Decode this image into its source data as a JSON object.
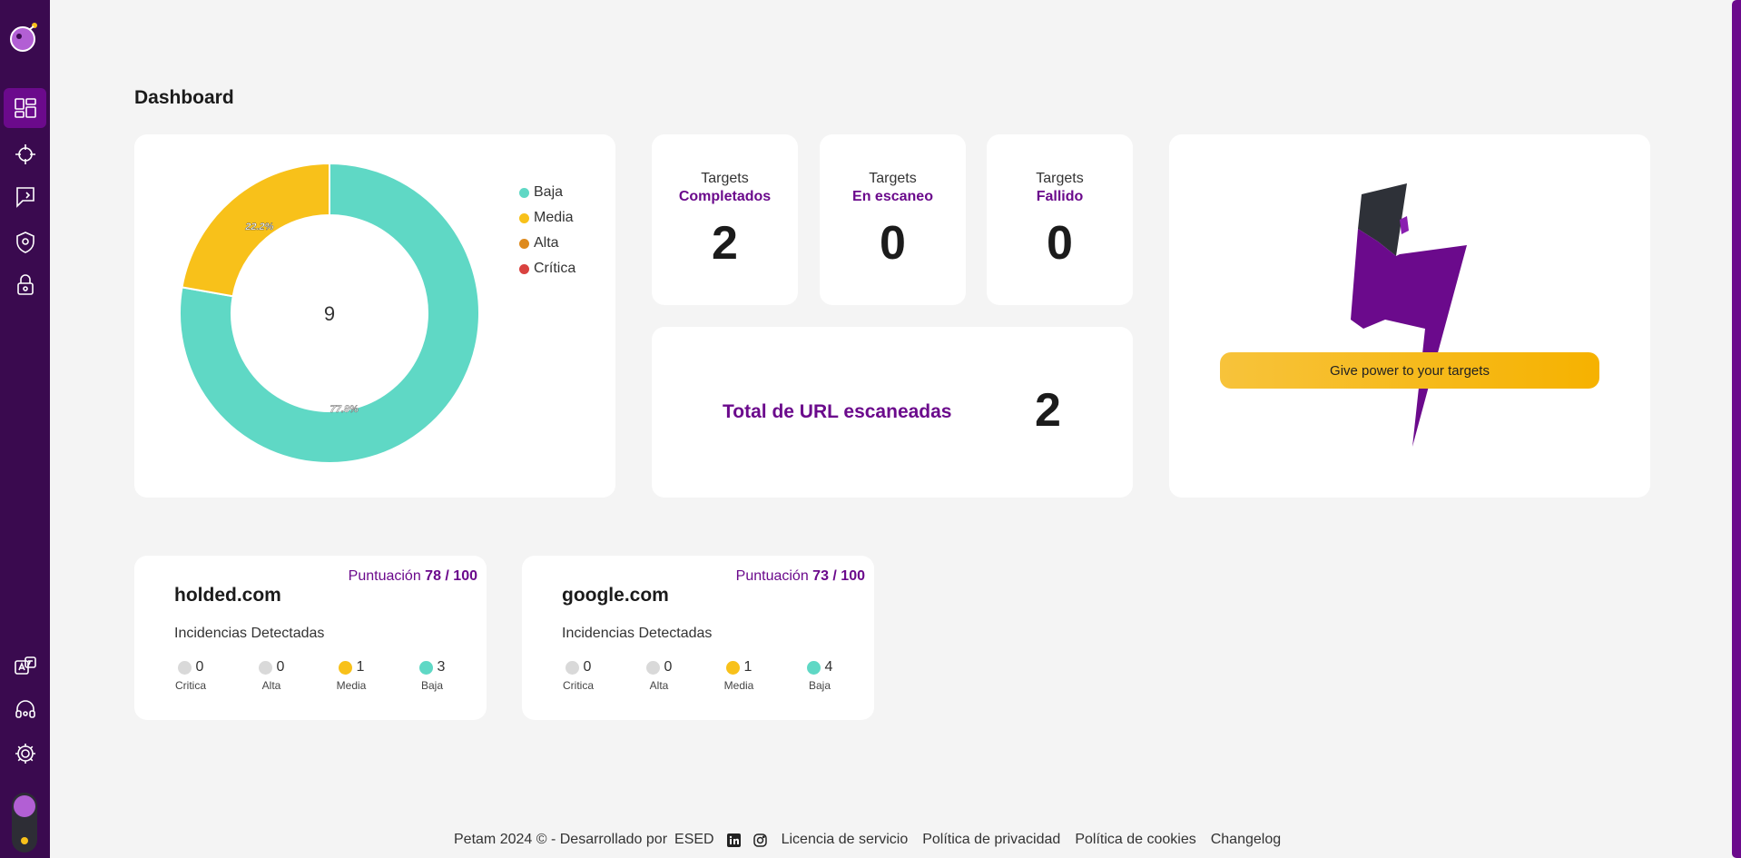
{
  "page": {
    "title": "Dashboard"
  },
  "sidebar": {
    "items": [
      {
        "name": "dashboard",
        "icon": "dashboard-icon",
        "active": true
      },
      {
        "name": "targets",
        "icon": "crosshair-icon"
      },
      {
        "name": "reports",
        "icon": "flag-icon"
      },
      {
        "name": "security",
        "icon": "shield-icon"
      },
      {
        "name": "lock",
        "icon": "lock-icon"
      },
      {
        "name": "language",
        "icon": "translate-icon"
      },
      {
        "name": "support",
        "icon": "headset-icon"
      },
      {
        "name": "settings",
        "icon": "gear-icon"
      }
    ],
    "theme_toggle": "theme-toggle"
  },
  "donut": {
    "center_value": "9",
    "legend": [
      {
        "label": "Baja",
        "color": "#5fd8c5"
      },
      {
        "label": "Media",
        "color": "#f8c11a"
      },
      {
        "label": "Alta",
        "color": "#de8a1c"
      },
      {
        "label": "Crítica",
        "color": "#d9423f"
      }
    ],
    "slice_labels": {
      "baja": "77.8%",
      "media": "22.2%"
    }
  },
  "stats": [
    {
      "label_top": "Targets",
      "label_bottom": "Completados",
      "value": "2"
    },
    {
      "label_top": "Targets",
      "label_bottom": "En escaneo",
      "value": "0"
    },
    {
      "label_top": "Targets",
      "label_bottom": "Fallido",
      "value": "0"
    }
  ],
  "total": {
    "label": "Total de URL escaneadas",
    "value": "2"
  },
  "power": {
    "button_label": "Give power to your targets"
  },
  "targets": [
    {
      "score_label": "Puntuación",
      "score": "78 / 100",
      "name": "holded.com",
      "incidents_label": "Incidencias Detectadas",
      "severities": [
        {
          "label": "Critica",
          "count": "0",
          "color": "#d9d9d9"
        },
        {
          "label": "Alta",
          "count": "0",
          "color": "#d9d9d9"
        },
        {
          "label": "Media",
          "count": "1",
          "color": "#f8c11a"
        },
        {
          "label": "Baja",
          "count": "3",
          "color": "#5fd8c5"
        }
      ]
    },
    {
      "score_label": "Puntuación",
      "score": "73 / 100",
      "name": "google.com",
      "incidents_label": "Incidencias Detectadas",
      "severities": [
        {
          "label": "Critica",
          "count": "0",
          "color": "#d9d9d9"
        },
        {
          "label": "Alta",
          "count": "0",
          "color": "#d9d9d9"
        },
        {
          "label": "Media",
          "count": "1",
          "color": "#f8c11a"
        },
        {
          "label": "Baja",
          "count": "4",
          "color": "#5fd8c5"
        }
      ]
    }
  ],
  "footer": {
    "copyright": "Petam 2024 © - Desarrollado por",
    "company": "ESED",
    "links": [
      "Licencia de servicio",
      "Política de privacidad",
      "Política de cookies",
      "Changelog"
    ]
  },
  "chart_data": {
    "type": "pie",
    "categories": [
      "Baja",
      "Media",
      "Alta",
      "Crítica"
    ],
    "values": [
      7,
      2,
      0,
      0
    ],
    "total": 9,
    "colors": [
      "#5fd8c5",
      "#f8c11a",
      "#de8a1c",
      "#d9423f"
    ],
    "legend": "right"
  }
}
